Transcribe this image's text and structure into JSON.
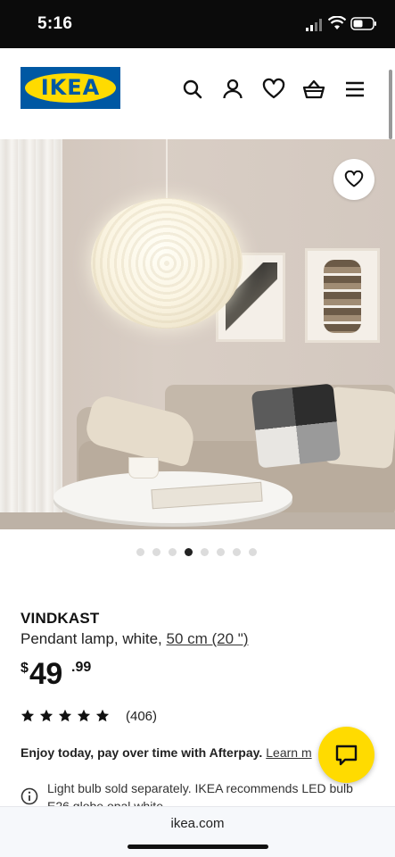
{
  "status_bar": {
    "time": "5:16",
    "icons": [
      "signal-icon",
      "wifi-icon",
      "battery-icon"
    ]
  },
  "header": {
    "logo_text": "IKEA",
    "logo_colors": {
      "blue": "#0058a3",
      "yellow": "#ffdb00"
    },
    "icons": [
      "search-icon",
      "account-icon",
      "heart-icon",
      "basket-icon",
      "menu-icon"
    ]
  },
  "hero": {
    "favorite_icon": "heart-icon",
    "carousel_total": 8,
    "carousel_active": 4
  },
  "product": {
    "name": "VINDKAST",
    "description": "Pendant lamp, white,",
    "size": "50 cm (20 \")",
    "price": {
      "currency": "$",
      "whole": "49",
      "decimal": ".99"
    },
    "rating_stars": 5,
    "review_count": "(406)"
  },
  "afterpay": {
    "text": "Enjoy today, pay over time with Afterpay.",
    "link": "Learn m"
  },
  "notice": {
    "icon": "info-icon",
    "text": "Light bulb sold separately. IKEA recommends LED bulb E26 globe opal white"
  },
  "chat": {
    "icon": "chat-icon",
    "color": "#ffdb00"
  },
  "browser": {
    "url": "ikea.com"
  }
}
